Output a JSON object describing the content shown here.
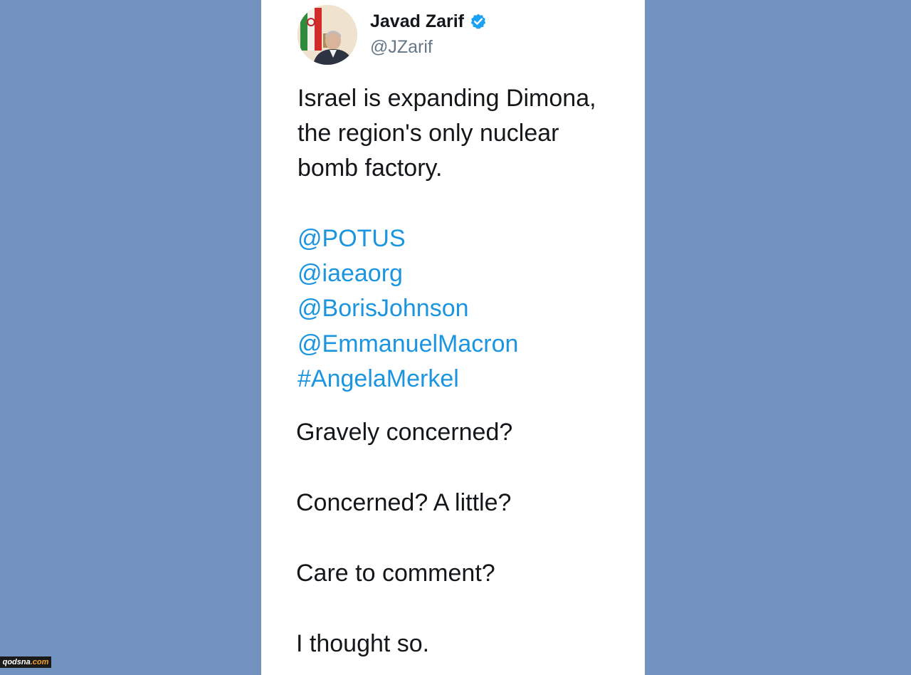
{
  "tweet": {
    "display_name": "Javad Zarif",
    "handle": "@JZarif",
    "body_lines": [
      "Israel is expanding Dimona,",
      "the region's only nuclear",
      "bomb factory."
    ],
    "mentions": [
      "@POTUS",
      "@iaeaorg",
      "@BorisJohnson",
      "@EmmanuelMacron",
      "#AngelaMerkel"
    ],
    "questions": [
      "Gravely concerned?",
      "Concerned?  A little?",
      "Care to comment?",
      "I thought so."
    ]
  },
  "watermark": {
    "site": "qodsna",
    "tld": ".com"
  },
  "icons": {
    "verified": "verified-badge-icon",
    "avatar": "profile-photo"
  },
  "colors": {
    "background": "#7292c0",
    "card": "#ffffff",
    "text": "#14171a",
    "handle": "#657786",
    "link": "#1b95e0",
    "verified": "#1da1f2"
  }
}
